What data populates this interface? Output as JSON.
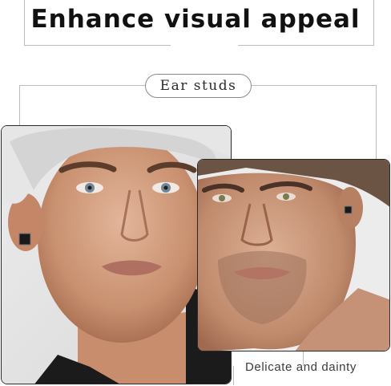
{
  "header": {
    "title": "Enhance visual appeal"
  },
  "label": {
    "text": "Ear studs"
  },
  "caption": {
    "text": "Delicate and dainty"
  },
  "colors": {
    "text": "#111111",
    "frame_line": "#bdbdbd",
    "stud": "#1a1a1a"
  }
}
